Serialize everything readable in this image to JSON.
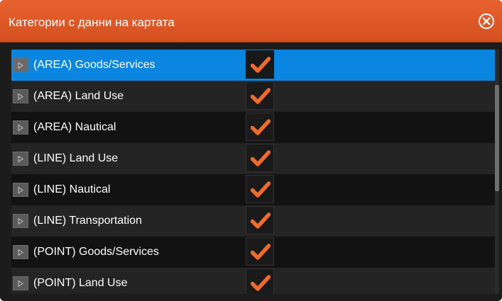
{
  "dialog": {
    "title": "Категории с данни на картата",
    "close_icon": "close-circle-icon",
    "accent_color": "#e35d2a",
    "selection_color": "#0b86e0",
    "check_color": "#f06a2c"
  },
  "list": {
    "items": [
      {
        "label": "(AREA) Goods/Services",
        "checked": true,
        "selected": true
      },
      {
        "label": "(AREA) Land Use",
        "checked": true,
        "selected": false
      },
      {
        "label": "(AREA) Nautical",
        "checked": true,
        "selected": false
      },
      {
        "label": "(LINE) Land Use",
        "checked": true,
        "selected": false
      },
      {
        "label": "(LINE) Nautical",
        "checked": true,
        "selected": false
      },
      {
        "label": "(LINE) Transportation",
        "checked": true,
        "selected": false
      },
      {
        "label": "(POINT) Goods/Services",
        "checked": true,
        "selected": false
      },
      {
        "label": "(POINT) Land Use",
        "checked": true,
        "selected": false
      }
    ]
  }
}
